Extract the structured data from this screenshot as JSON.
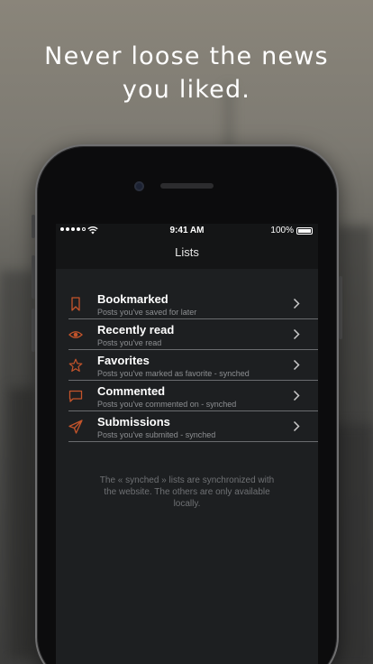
{
  "headline": {
    "line1": "Never loose the news",
    "line2": "you liked."
  },
  "status_bar": {
    "time": "9:41 AM",
    "battery": "100%"
  },
  "nav": {
    "title": "Lists"
  },
  "lists": [
    {
      "title": "Bookmarked",
      "subtitle": "Posts you've saved for later",
      "icon": "bookmark-icon"
    },
    {
      "title": "Recently read",
      "subtitle": "Posts you've read",
      "icon": "eye-icon"
    },
    {
      "title": "Favorites",
      "subtitle": "Posts you've marked as favorite - synched",
      "icon": "star-icon"
    },
    {
      "title": "Commented",
      "subtitle": "Posts you've commented on - synched",
      "icon": "comment-icon"
    },
    {
      "title": "Submissions",
      "subtitle": "Posts you've submited - synched",
      "icon": "send-icon"
    }
  ],
  "footnote": "The « synched » lists are synchronized with the website. The others are only available locally.",
  "colors": {
    "accent": "#c4542b",
    "screen_bg": "#1d1f21",
    "bar_bg": "#141516"
  }
}
